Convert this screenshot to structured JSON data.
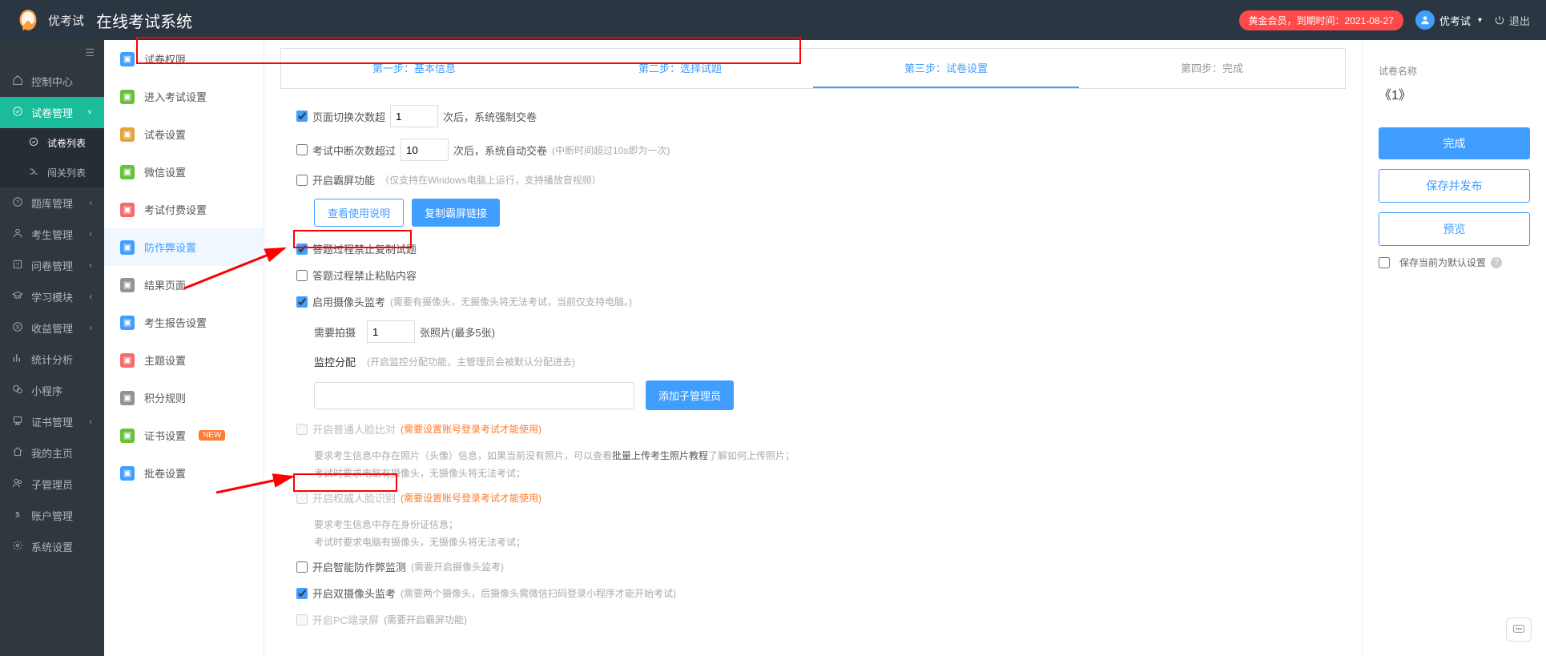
{
  "header": {
    "brand": "优考试",
    "system_name": "在线考试系统",
    "member_badge": "黄金会员，到期时间：2021-08-27",
    "user_name": "优考试",
    "logout_label": "退出"
  },
  "sidebar_main": {
    "items": [
      {
        "icon": "home",
        "label": "控制中心",
        "expandable": false
      },
      {
        "icon": "paper",
        "label": "试卷管理",
        "expandable": true,
        "active": true,
        "children": [
          {
            "icon": "list",
            "label": "试卷列表",
            "active": true
          },
          {
            "icon": "shuffle",
            "label": "闯关列表"
          }
        ]
      },
      {
        "icon": "db",
        "label": "题库管理",
        "expandable": true
      },
      {
        "icon": "user",
        "label": "考生管理",
        "expandable": true
      },
      {
        "icon": "question",
        "label": "问卷管理",
        "expandable": true
      },
      {
        "icon": "grad",
        "label": "学习模块",
        "expandable": true
      },
      {
        "icon": "coin",
        "label": "收益管理",
        "expandable": true
      },
      {
        "icon": "chart",
        "label": "统计分析"
      },
      {
        "icon": "wechat",
        "label": "小程序"
      },
      {
        "icon": "cert",
        "label": "证书管理",
        "expandable": true
      },
      {
        "icon": "myhome",
        "label": "我的主页"
      },
      {
        "icon": "admin",
        "label": "子管理员"
      },
      {
        "icon": "account",
        "label": "账户管理"
      },
      {
        "icon": "gear",
        "label": "系统设置"
      }
    ]
  },
  "sidebar_secondary": {
    "items": [
      {
        "color": "#409eff",
        "label": "试卷权限"
      },
      {
        "color": "#67c23a",
        "label": "进入考试设置"
      },
      {
        "color": "#e6a23c",
        "label": "试卷设置"
      },
      {
        "color": "#67c23a",
        "label": "微信设置"
      },
      {
        "color": "#f56c6c",
        "label": "考试付费设置"
      },
      {
        "color": "#409eff",
        "label": "防作弊设置",
        "active": true
      },
      {
        "color": "#909399",
        "label": "结果页面"
      },
      {
        "color": "#409eff",
        "label": "考生报告设置"
      },
      {
        "color": "#f56c6c",
        "label": "主题设置"
      },
      {
        "color": "#909399",
        "label": "积分规则"
      },
      {
        "color": "#67c23a",
        "label": "证书设置",
        "new": true
      },
      {
        "color": "#409eff",
        "label": "批卷设置"
      }
    ],
    "new_tag": "NEW"
  },
  "steps": {
    "s1": "第一步：基本信息",
    "s2": "第二步：选择试题",
    "s3": "第三步：试卷设置",
    "s4": "第四步：完成"
  },
  "form": {
    "page_switch_label": "页面切换次数超",
    "page_switch_value": "1",
    "page_switch_suffix": "次后，系统强制交卷",
    "interrupt_label": "考试中断次数超过",
    "interrupt_value": "10",
    "interrupt_suffix": "次后，系统自动交卷",
    "interrupt_hint": "(中断时间超过10s即为一次)",
    "fullscreen_label": "开启霸屏功能",
    "fullscreen_hint": "（仅支持在Windows电脑上运行，支持播放音视频）",
    "btn_view_instructions": "查看使用说明",
    "btn_copy_link": "复制霸屏链接",
    "no_copy_label": "答题过程禁止复制试题",
    "no_paste_label": "答题过程禁止粘贴内容",
    "camera_label": "启用摄像头监考",
    "camera_hint": "(需要有摄像头，无摄像头将无法考试，当前仅支持电脑。)",
    "photo_label": "需要拍摄",
    "photo_value": "1",
    "photo_suffix": "张照片(最多5张)",
    "monitor_alloc_label": "监控分配",
    "monitor_alloc_hint": "(开启监控分配功能，主管理员会被默认分配进去)",
    "add_subadmin_btn": "添加子管理员",
    "face_basic_label": "开启普通人脸比对",
    "face_basic_warn": "(需要设置账号登录考试才能使用)",
    "face_basic_desc_1_pre": "要求考生信息中存在照片（头像）信息，如果当前没有照片，可以查看",
    "face_basic_desc_1_link": "批量上传考生照片教程",
    "face_basic_desc_1_post": "了解如何上传照片；",
    "face_basic_desc_2": "考试时要求电脑有摄像头，无摄像头将无法考试；",
    "face_authority_label": "开启权威人脸识别",
    "face_authority_warn": "(需要设置账号登录考试才能使用)",
    "face_authority_desc_1": "要求考生信息中存在身份证信息；",
    "face_authority_desc_2": "考试时要求电脑有摄像头，无摄像头将无法考试；",
    "smart_cheat_label": "开启智能防作弊监测",
    "smart_cheat_hint": "(需要开启摄像头监考)",
    "dual_camera_label": "开启双摄像头监考",
    "dual_camera_hint": "(需要两个摄像头，后摄像头需微信扫码登录小程序才能开始考试)",
    "pc_record_label": "开启PC端录屏",
    "pc_record_hint": "(需要开启霸屏功能)"
  },
  "right_panel": {
    "name_label": "试卷名称",
    "paper_name": "《1》",
    "btn_finish": "完成",
    "btn_save_publish": "保存并发布",
    "btn_preview": "预览",
    "save_default_label": "保存当前为默认设置"
  }
}
